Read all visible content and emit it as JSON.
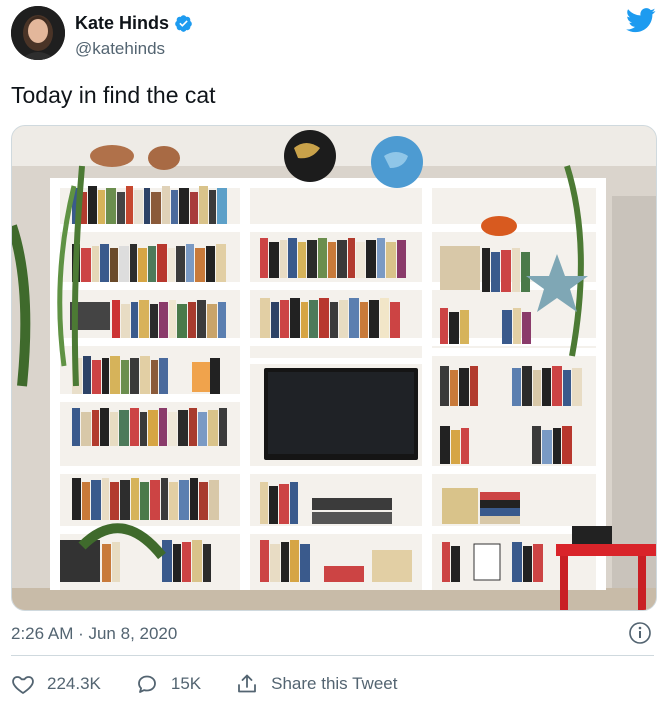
{
  "user": {
    "name": "Kate Hinds",
    "handle": "@katehinds"
  },
  "tweet": {
    "text": "Today in find the cat",
    "timestamp": "2:26 AM · Jun 8, 2020"
  },
  "stats": {
    "likes": "224.3K",
    "replies": "15K",
    "share_label": "Share this Tweet"
  },
  "colors": {
    "brand": "#1d9bf0",
    "secondary_text": "#536471",
    "border": "#cfd9de"
  },
  "icons": [
    "verified-badge-icon",
    "twitter-bird-icon",
    "info-icon",
    "heart-icon",
    "reply-icon",
    "share-icon"
  ]
}
